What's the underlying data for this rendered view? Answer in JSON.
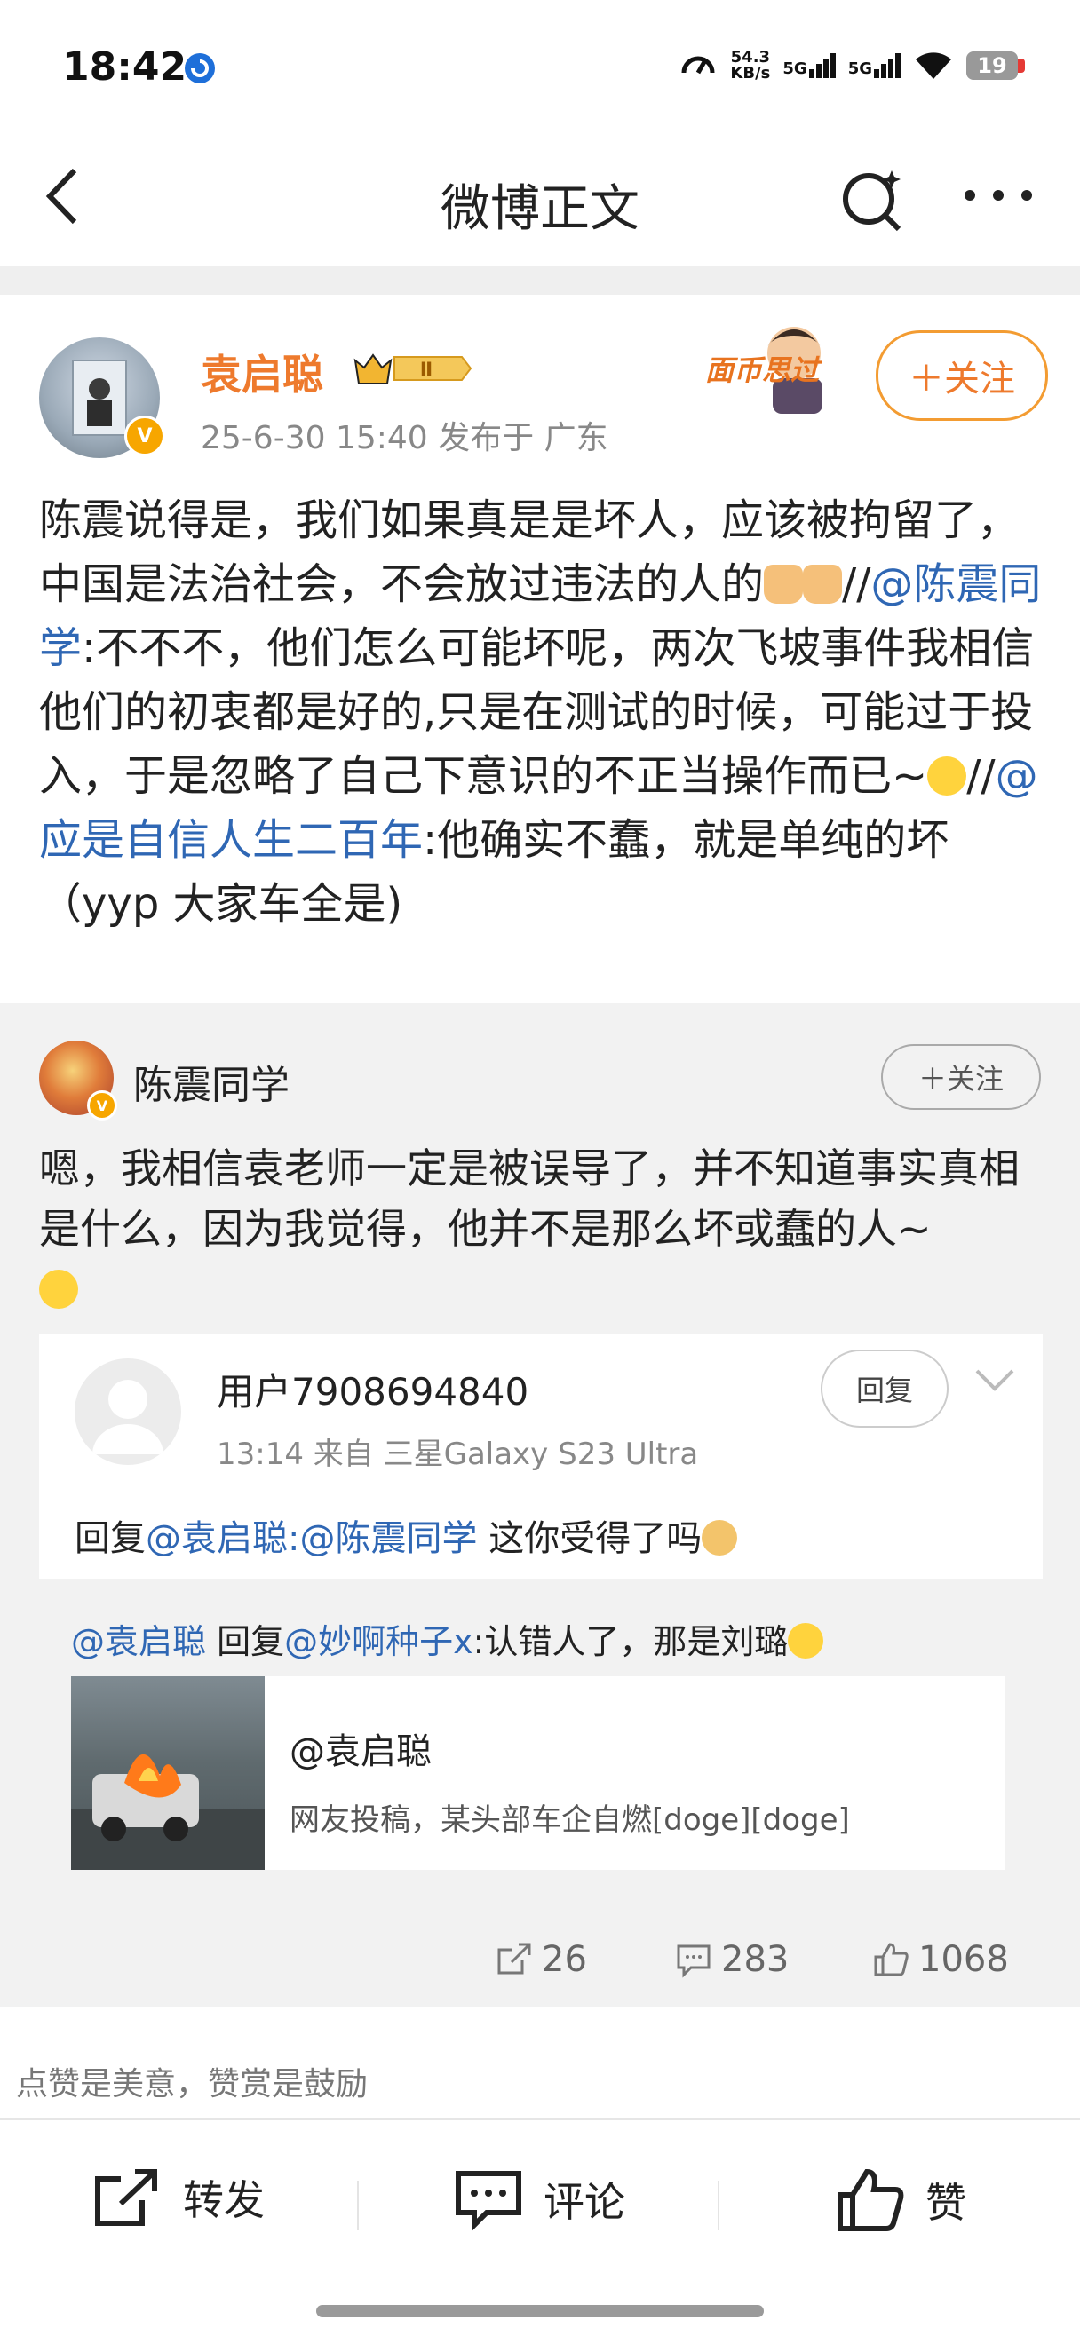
{
  "status_bar": {
    "time": "18:42",
    "speed_value": "54.3",
    "speed_unit": "KB/s",
    "net1": "5G",
    "net2": "5G",
    "battery": "19"
  },
  "nav": {
    "title": "微博正文"
  },
  "author": {
    "name": "袁启聪",
    "badge_level": "Ⅱ",
    "meta": "25-6-30 15:40   发布于 广东",
    "sticker_text": "面币思过",
    "follow_label": "＋关注"
  },
  "post": {
    "segments": [
      {
        "text": "陈震说得是，我们如果真是是坏人，应该被拘留了，中国是法治社会，不会放过违法的人的"
      },
      {
        "emoji": "folded-hands-icon"
      },
      {
        "emoji": "folded-hands-icon"
      },
      {
        "text": "//"
      },
      {
        "link": "@陈震同学"
      },
      {
        "text": ":不不不，他们怎么可能坏呢，两次飞坡事件我相信 他们的初衷都是好的,只是在测试的时候，可能过于投入，于是忽略了自己下意识的不正当操作而已~"
      },
      {
        "emoji": "crying-laughing-icon"
      },
      {
        "text": "//"
      },
      {
        "link": "@应是自信人生二百年"
      },
      {
        "text": ":他确实不蠢，就是单纯的坏（yyp 大家车全是)"
      }
    ]
  },
  "repost": {
    "name": "陈震同学",
    "follow_label": "＋关注",
    "text": "嗯，我相信袁老师一定是被误导了，并不知道事实真相是什么，因为我觉得，他并不是那么坏或蠢的人~"
  },
  "comment": {
    "user": "用户7908694840",
    "meta": "13:14   来自 三星Galaxy S23 Ultra",
    "reply_label": "回复",
    "prefix": "回复",
    "mention1": "@袁启聪",
    "colon": ":",
    "mention2": "@陈震同学",
    "body": " 这你受得了吗"
  },
  "reply": {
    "mention1": "@袁启聪",
    "mid": " 回复",
    "mention2": "@妙啊种子x",
    "text": ":认错人了，那是刘璐"
  },
  "link_card": {
    "title": "@袁启聪",
    "desc": "网友投稿，某头部车企自燃[doge][doge]"
  },
  "stats": {
    "reposts": "26",
    "comments": "283",
    "likes": "1068"
  },
  "tip": "点赞是美意，赞赏是鼓励",
  "bottom_bar": {
    "repost": "转发",
    "comment": "评论",
    "like": "赞"
  }
}
